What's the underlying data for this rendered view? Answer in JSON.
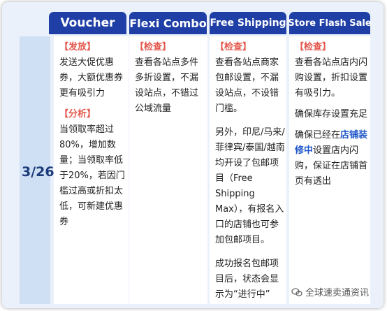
{
  "headers": {
    "voucher": "Voucher",
    "flexi_combo": "Flexi Combo",
    "free_shipping": "Free Shipping",
    "store_flash_sale": "Store Flash Sale"
  },
  "date": "3/26",
  "voucher": {
    "tag1": "【发放】",
    "text1": "发送大促优惠券，大额优惠券更有吸引力",
    "tag2": "【分析】",
    "text2": "当领取率超过80%，增加数量；当领取率低于20%，若因门槛过高或折扣太低，可新建优惠券"
  },
  "flexi_combo": {
    "tag": "【检查】",
    "text": "查看各站点多件多折设置，不漏设站点，不错过公域流量"
  },
  "free_shipping": {
    "tag": "【检查】",
    "text1": "查看各站点商家包邮设置，不漏设站点，不设错门槛。",
    "text2": "另外，印尼/马来/菲律宾/泰国/越南均开设了包邮项目（Free Shipping Max），有报名入口的店铺也可参加包邮项目。",
    "text3": "成功报名包邮项目后，状态会显示为“进行中”"
  },
  "store_flash_sale": {
    "tag": "【检查】",
    "text1": "查看各站点店内闪购设置，折扣设置有吸引力。",
    "text2": "确保库存设置充足",
    "text3_pre": "确保已经在",
    "text3_hl": "店铺装修中",
    "text3_post": "设置店内闪购，保证在店铺首页有透出"
  },
  "watermark": {
    "text": "全球速卖通资讯",
    "icon": "chat-bubble-icon"
  },
  "colors": {
    "header_bg": "#1f3fa6",
    "tag": "#e4584e",
    "highlight": "#1f56c9",
    "date": "#1c3b78"
  }
}
